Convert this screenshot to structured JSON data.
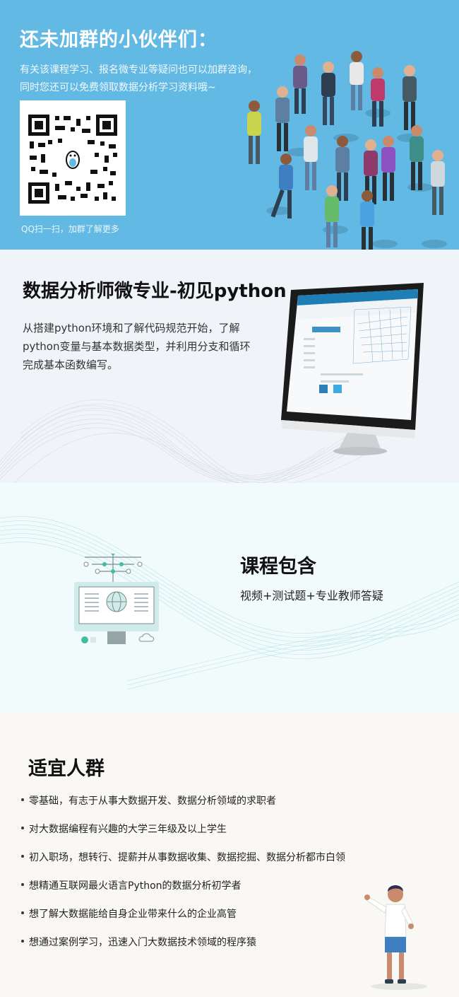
{
  "group": {
    "title": "还未加群的小伙伴们：",
    "desc_line1": "有关该课程学习、报名微专业等疑问也可以加群咨询，",
    "desc_line2": "同时您还可以免费领取数据分析学习资料哦~",
    "qr_caption": "QQ扫一扫，加群了解更多"
  },
  "course": {
    "title": "数据分析师微专业-初见python",
    "desc_line1": "从搭建python环境和了解代码规范开始，了解",
    "desc_line2": "python变量与基本数据类型，并利用分支和循环",
    "desc_line3": "完成基本函数编写。"
  },
  "includes": {
    "title": "课程包含",
    "items": "视频+测试题+专业教师答疑"
  },
  "audience": {
    "title": "适宜人群",
    "items": [
      "零基础，有志于从事大数据开发、数据分析领域的求职者",
      "对大数据编程有兴趣的大学三年级及以上学生",
      "初入职场，想转行、提薪并从事数据收集、数据挖掘、数据分析都市白领",
      "想精通互联网最火语言Python的数据分析初学者",
      "想了解大数据能给自身企业带来什么的企业高管",
      "想通过案例学习，迅速入门大数据技术领域的程序猿"
    ]
  },
  "colors": {
    "banner_bg": "#62b9e3",
    "accent_teal": "#3fbf9f"
  }
}
